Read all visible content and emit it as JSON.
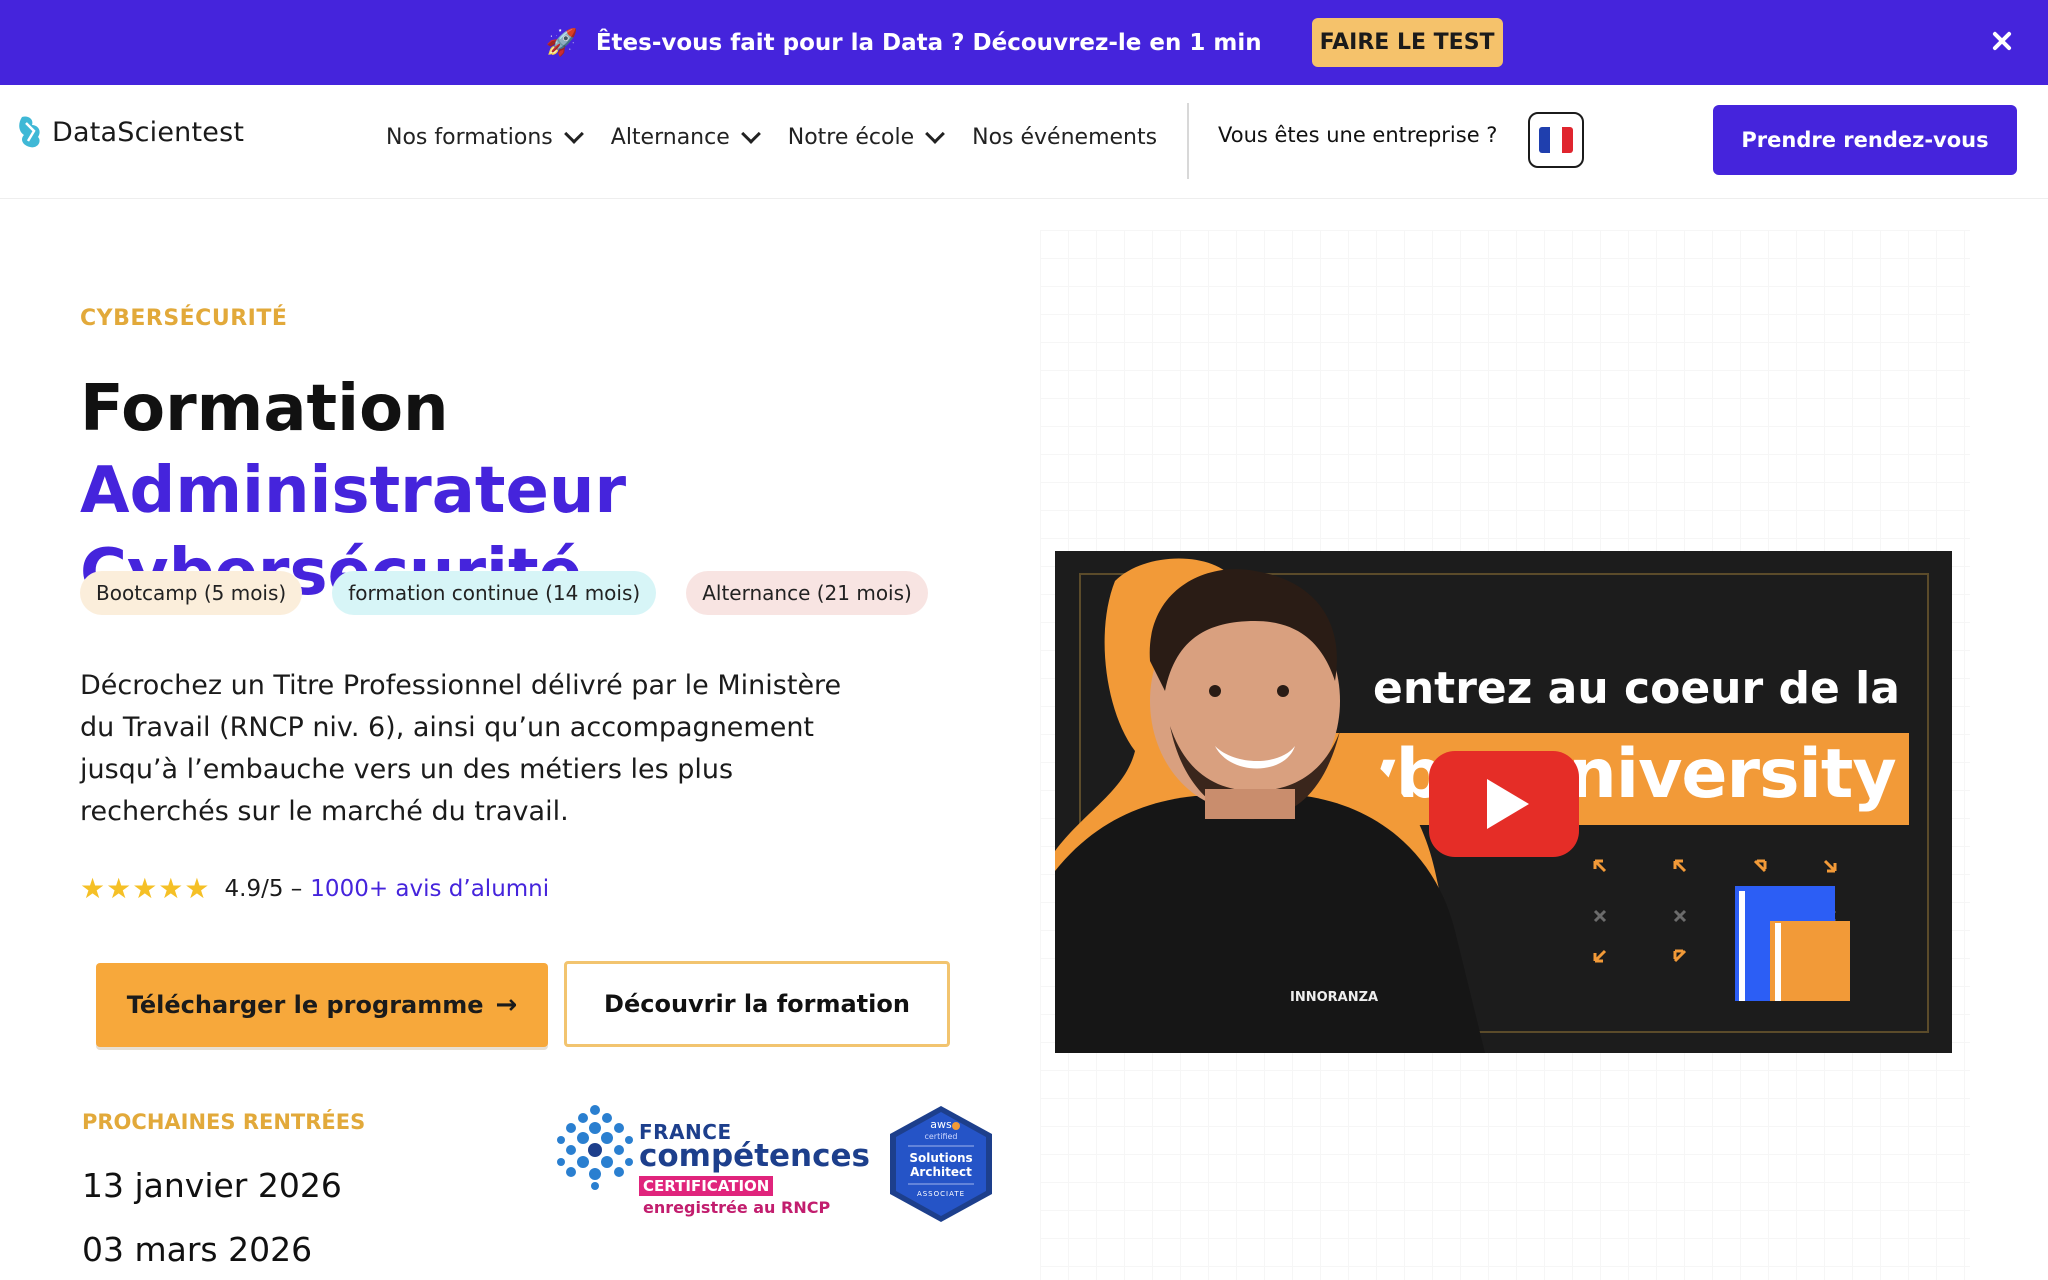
{
  "banner": {
    "icon": "rocket-icon",
    "message": "Êtes-vous fait pour la Data ? Découvrez-le en 1 min",
    "cta_label": "FAIRE LE TEST"
  },
  "header": {
    "logo_text": "DataScientest",
    "nav": [
      {
        "label": "Nos formations",
        "has_dropdown": true
      },
      {
        "label": "Alternance",
        "has_dropdown": true
      },
      {
        "label": "Notre école",
        "has_dropdown": true
      },
      {
        "label": "Nos événements",
        "has_dropdown": false
      }
    ],
    "enterprise_link": "Vous êtes une entreprise ?",
    "language": "fr",
    "cta_label": "Prendre rendez-vous"
  },
  "hero": {
    "eyebrow": "CYBERSÉCURITÉ",
    "title_plain": "Formation ",
    "title_accent_1": "Administrateur",
    "title_accent_2": "Cybersécurité",
    "tags": [
      "Bootcamp (5 mois)",
      "formation continue (14 mois)",
      "Alternance (21 mois)"
    ],
    "description": "Décrochez un Titre Professionnel délivré par le Ministère du Travail (RNCP niv. 6), ainsi qu’un accompagnement jusqu’à l’embauche vers un des métiers les plus recherchés sur le marché du travail.",
    "rating": {
      "stars": 5,
      "score": "4.9/5 –",
      "reviews_link": "1000+ avis d’alumni"
    },
    "download_button": "Télécharger le programme",
    "discover_button": "Découvrir la formation",
    "next_starts_label": "PROCHAINES RENTRÉES",
    "next_starts": [
      "13 janvier 2026",
      "03 mars 2026"
    ]
  },
  "certifications": {
    "france_competences": {
      "line1": "FRANCE",
      "line2": "compétences",
      "line3": "CERTIFICATION",
      "line4": "enregistrée au RNCP"
    },
    "aws": {
      "line1": "aws",
      "line2": "certified",
      "line3": "Solutions",
      "line4": "Architect",
      "line5": "ASSOCIATE"
    }
  },
  "video": {
    "headline": "entrez au coeur de la",
    "band_text": "cyberuniversity",
    "shirt_text": "INNORANZA",
    "play_icon": "youtube-play-icon"
  },
  "colors": {
    "brand": "#4524dc",
    "accent_orange": "#f7a83b",
    "eyebrow_gold": "#e2a93a"
  }
}
